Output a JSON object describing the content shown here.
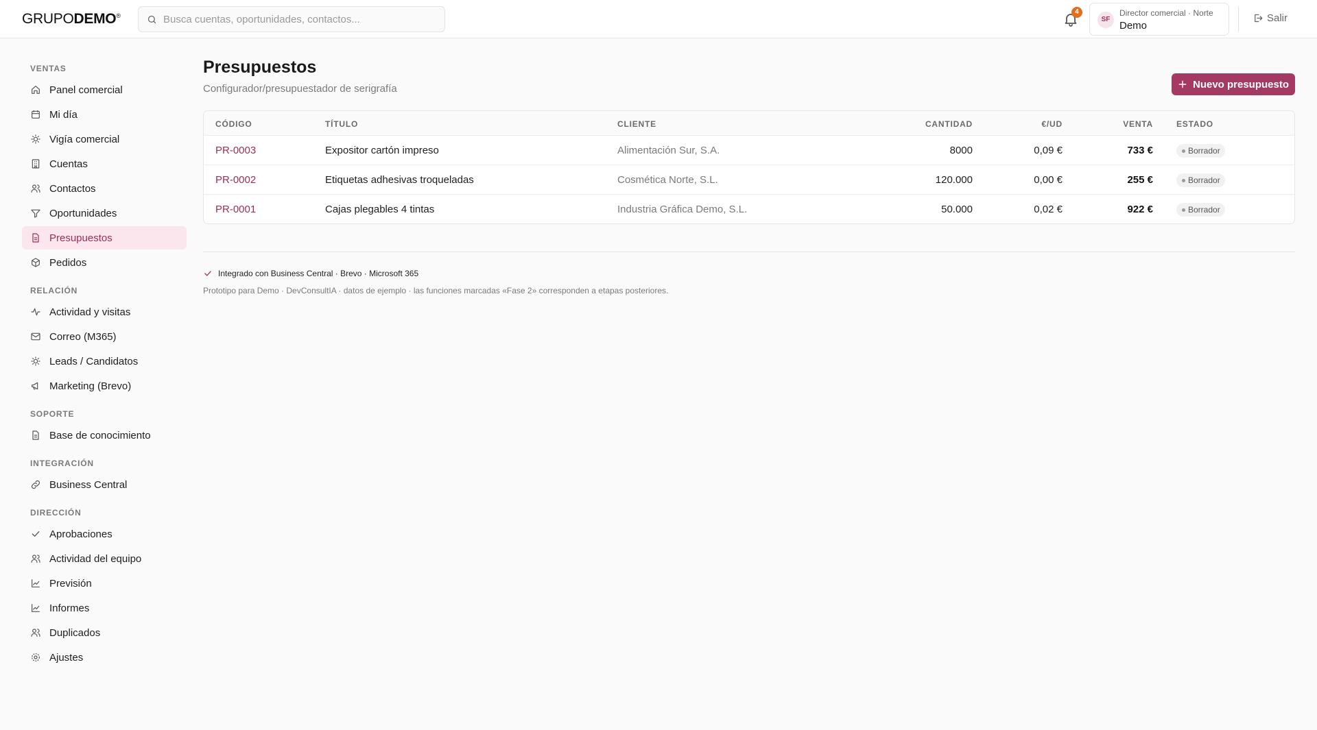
{
  "header": {
    "logo_light": "GRUPO",
    "logo_bold": "DEMO",
    "logo_reg": "®",
    "search_placeholder": "Busca cuentas, oportunidades, contactos...",
    "notification_count": "4",
    "user": {
      "initials": "SF",
      "role": "Director comercial · Norte",
      "name": "Demo"
    },
    "logout_label": "Salir"
  },
  "sidebar": {
    "sections": {
      "ventas": "VENTAS",
      "relacion": "RELACIÓN",
      "soporte": "SOPORTE",
      "integracion": "INTEGRACIÓN",
      "direccion": "DIRECCIÓN"
    },
    "items": [
      {
        "label": "Panel comercial",
        "icon": "home-icon"
      },
      {
        "label": "Mi día",
        "icon": "calendar-icon"
      },
      {
        "label": "Vigía comercial",
        "icon": "radar-icon"
      },
      {
        "label": "Cuentas",
        "icon": "building-icon"
      },
      {
        "label": "Contactos",
        "icon": "users-icon"
      },
      {
        "label": "Oportunidades",
        "icon": "filter-icon"
      },
      {
        "label": "Presupuestos",
        "icon": "document-icon",
        "active": true
      },
      {
        "label": "Pedidos",
        "icon": "box-icon"
      },
      {
        "label": "Actividad y visitas",
        "icon": "activity-icon"
      },
      {
        "label": "Correo (M365)",
        "icon": "mail-icon"
      },
      {
        "label": "Leads / Candidatos",
        "icon": "lightbulb-icon"
      },
      {
        "label": "Marketing (Brevo)",
        "icon": "megaphone-icon"
      },
      {
        "label": "Base de conocimiento",
        "icon": "document-icon"
      },
      {
        "label": "Business Central",
        "icon": "link-icon"
      },
      {
        "label": "Aprobaciones",
        "icon": "check-icon"
      },
      {
        "label": "Actividad del equipo",
        "icon": "users-icon"
      },
      {
        "label": "Previsión",
        "icon": "chart-icon"
      },
      {
        "label": "Informes",
        "icon": "chart-icon"
      },
      {
        "label": "Duplicados",
        "icon": "users-icon"
      },
      {
        "label": "Ajustes",
        "icon": "gear-icon"
      }
    ]
  },
  "main": {
    "title": "Presupuestos",
    "subtitle": "Configurador/presupuestador de serigrafía",
    "new_button": "Nuevo presupuesto",
    "table": {
      "headers": {
        "code": "CÓDIGO",
        "title": "TÍTULO",
        "client": "CLIENTE",
        "qty": "CANTIDAD",
        "unit": "€/UD",
        "sale": "VENTA",
        "status": "ESTADO"
      },
      "rows": [
        {
          "code": "PR-0003",
          "title": "Expositor cartón impreso",
          "client": "Alimentación Sur, S.A.",
          "qty": "8000",
          "unit": "0,09 €",
          "sale": "733 €",
          "status": "Borrador"
        },
        {
          "code": "PR-0002",
          "title": "Etiquetas adhesivas troqueladas",
          "client": "Cosmética Norte, S.L.",
          "qty": "120.000",
          "unit": "0,00 €",
          "sale": "255 €",
          "status": "Borrador"
        },
        {
          "code": "PR-0001",
          "title": "Cajas plegables 4 tintas",
          "client": "Industria Gráfica Demo, S.L.",
          "qty": "50.000",
          "unit": "0,02 €",
          "sale": "922 €",
          "status": "Borrador"
        }
      ]
    },
    "integration_note": "Integrado con Business Central · Brevo · Microsoft 365",
    "prototype_note": "Prototipo para Demo · DevConsultIA · datos de ejemplo · las funciones marcadas «Fase 2» corresponden a etapas posteriores."
  },
  "colors": {
    "accent": "#a43a63",
    "accent_soft": "#fbe6ee",
    "badge_orange": "#e0701b"
  }
}
